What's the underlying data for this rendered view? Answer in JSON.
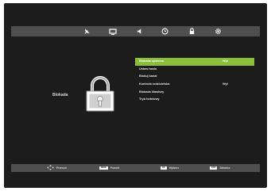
{
  "tabs": [
    {
      "icon": "satellite-icon"
    },
    {
      "icon": "picture-icon"
    },
    {
      "icon": "sound-icon"
    },
    {
      "icon": "clock-icon"
    },
    {
      "icon": "lock-icon"
    },
    {
      "icon": "settings-icon"
    }
  ],
  "section": {
    "title": "Blokada",
    "icon": "padlock-icon"
  },
  "menu": {
    "items": [
      {
        "label": "Blokada systemu",
        "value": "Wył",
        "selected": true
      },
      {
        "label": "Ustaw hasło",
        "value": ""
      },
      {
        "label": "Blokuj kanał",
        "value": ""
      },
      {
        "label": "Kontrola rodzicielska",
        "value": "Wył"
      },
      {
        "label": "Blokada klawiszy",
        "value": ""
      },
      {
        "label": "Tryb hotelowy",
        "value": ""
      }
    ]
  },
  "hints": {
    "move": {
      "icon": "dpad-icon",
      "label": "Przesuń"
    },
    "back": {
      "key": "MENU",
      "label": "Powrót"
    },
    "select": {
      "key": "OK",
      "label": "Wybierz"
    },
    "exit": {
      "key": "EXIT",
      "label": "Zakończ"
    }
  },
  "colors": {
    "background": "#1c1c1c",
    "bar": "#4e4e4e",
    "highlight": "#8bbf3b"
  }
}
